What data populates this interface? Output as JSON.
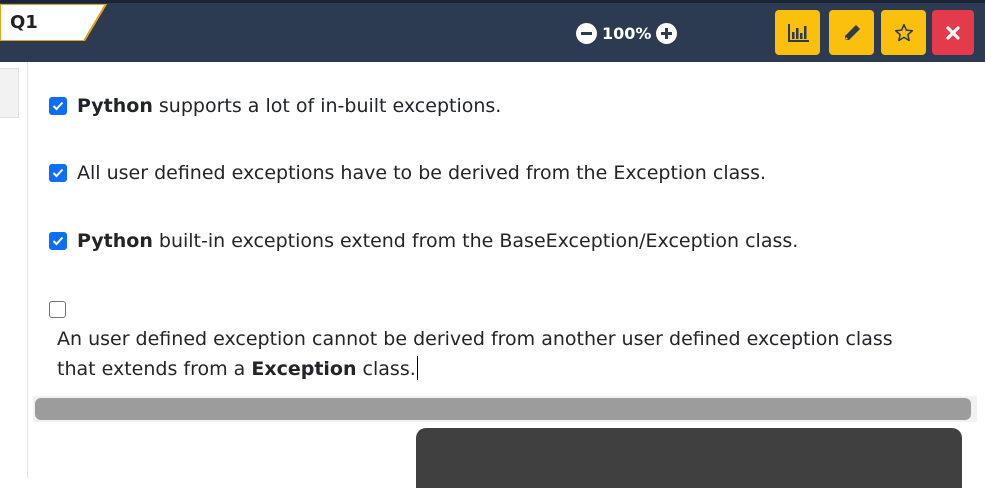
{
  "header": {
    "question_tab": "Q1",
    "zoom_value": "100%",
    "buttons": [
      {
        "name": "stats-button",
        "icon": "bar-chart-icon"
      },
      {
        "name": "edit-button",
        "icon": "pencil-icon"
      },
      {
        "name": "favorite-button",
        "icon": "star-icon"
      },
      {
        "name": "close-button",
        "icon": "close-icon"
      }
    ],
    "colors": {
      "bar": "#2c3a52",
      "accent": "#fbbf0d",
      "danger": "#e43a4b",
      "tab_border": "#e8a317"
    }
  },
  "options": [
    {
      "checked": true,
      "bold": "Python",
      "text": " supports a lot of in-built exceptions."
    },
    {
      "checked": true,
      "bold": "",
      "text": "All user defined exceptions have to be derived from the Exception class."
    },
    {
      "checked": true,
      "bold": "Python",
      "text": " built-in exceptions extend from the BaseException/Exception class."
    },
    {
      "checked": false,
      "text_before": "An user defined exception cannot be derived from another user defined exception class that extends from a ",
      "bold": "Exception",
      "text_after": " class."
    }
  ]
}
